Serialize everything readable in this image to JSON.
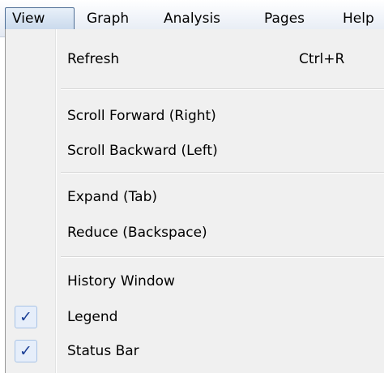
{
  "menubar": {
    "items": [
      {
        "label": "View",
        "active": true
      },
      {
        "label": "Graph"
      },
      {
        "label": "Analysis"
      },
      {
        "label": "Pages"
      },
      {
        "label": "Help"
      }
    ]
  },
  "view_menu": {
    "refresh": {
      "label": "Refresh",
      "shortcut": "Ctrl+R"
    },
    "scroll_forward": {
      "label": "Scroll Forward (Right)"
    },
    "scroll_backward": {
      "label": "Scroll Backward (Left)"
    },
    "expand": {
      "label": "Expand (Tab)"
    },
    "reduce": {
      "label": "Reduce (Backspace)"
    },
    "history_window": {
      "label": "History Window"
    },
    "legend": {
      "label": "Legend",
      "checked": true,
      "check_glyph": "✓"
    },
    "status_bar": {
      "label": "Status Bar",
      "checked": true,
      "check_glyph": "✓"
    }
  },
  "colors": {
    "menu_background": "#f0f0f0",
    "check_mark": "#1b3f96",
    "active_border": "#4f6f96"
  }
}
